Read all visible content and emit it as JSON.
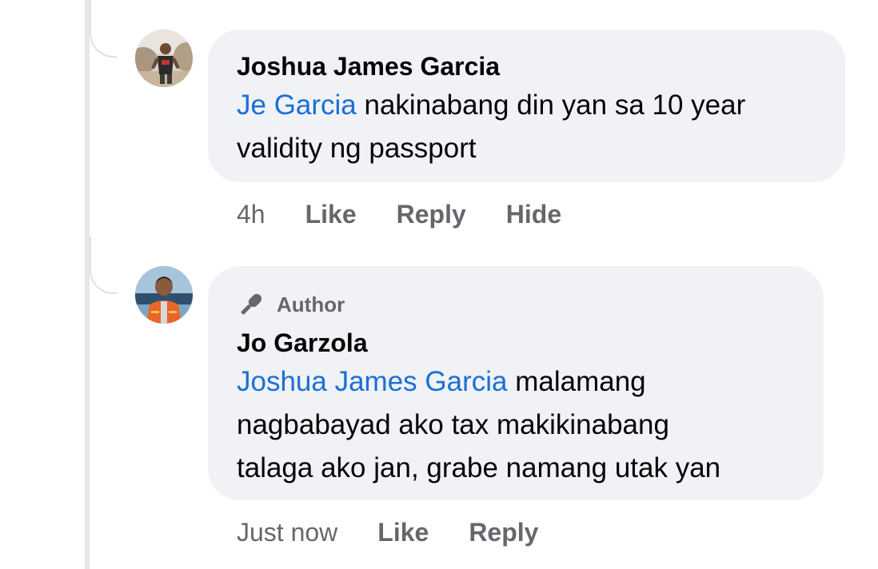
{
  "comments": [
    {
      "author": "Joshua James Garcia",
      "mention": "Je Garcia",
      "text_line1": " nakinabang din yan sa 10 year",
      "text_line2": "validity ng passport",
      "timestamp": "4h",
      "actions": {
        "like": "Like",
        "reply": "Reply",
        "hide": "Hide"
      },
      "avatar_icon": "profile-photo-icon"
    },
    {
      "badge": {
        "icon": "microphone-icon",
        "label": "Author"
      },
      "author": "Jo Garzola",
      "mention": "Joshua James Garcia",
      "text_line1": " malamang",
      "text_line2": "nagbabayad ako tax makikinabang",
      "text_line3": "talaga ako jan, grabe namang utak yan",
      "timestamp": "Just now",
      "actions": {
        "like": "Like",
        "reply": "Reply"
      },
      "avatar_icon": "profile-photo-icon"
    }
  ],
  "colors": {
    "bubble": "#f0f2f5",
    "mention": "#1a6fd6",
    "secondary_text": "#65676b",
    "primary_text": "#050505"
  }
}
